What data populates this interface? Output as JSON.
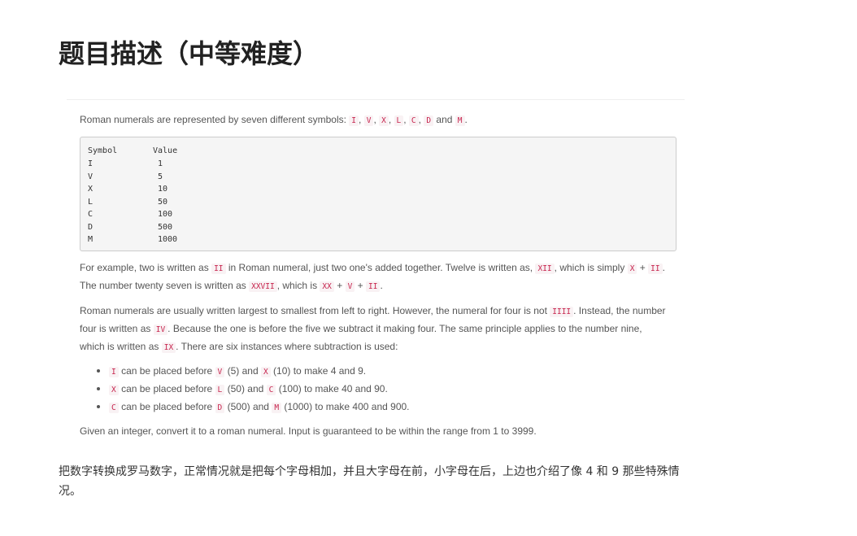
{
  "page_title": "题目描述（中等难度）",
  "intro": {
    "text": "Roman numerals are represented by seven different symbols:",
    "symbols": [
      "I",
      "V",
      "X",
      "L",
      "C",
      "D",
      "M"
    ],
    "and_word": "and",
    "end": "."
  },
  "table": {
    "headers": {
      "symbol": "Symbol",
      "value": "Value"
    },
    "rows": [
      {
        "symbol": "I",
        "value": "1"
      },
      {
        "symbol": "V",
        "value": "5"
      },
      {
        "symbol": "X",
        "value": "10"
      },
      {
        "symbol": "L",
        "value": "50"
      },
      {
        "symbol": "C",
        "value": "100"
      },
      {
        "symbol": "D",
        "value": "500"
      },
      {
        "symbol": "M",
        "value": "1000"
      }
    ]
  },
  "example": {
    "l1_a": "For example, two is written as",
    "l1_code1": "II",
    "l1_b": "in Roman numeral, just two one's added together. Twelve is written as,",
    "l1_code2": "XII",
    "l1_c": ", which is simply",
    "l1_code3": "X",
    "l1_plus": "+",
    "l1_code4": "II",
    "l1_end": ".",
    "l2_a": "The number twenty seven is written as",
    "l2_code1": "XXVII",
    "l2_b": ", which is",
    "l2_code2": "XX",
    "l2_plus1": "+",
    "l2_code3": "V",
    "l2_plus2": "+",
    "l2_code4": "II",
    "l2_end": "."
  },
  "order": {
    "l1_a": "Roman numerals are usually written largest to smallest from left to right. However, the numeral for four is not",
    "l1_code": "IIII",
    "l1_b": ". Instead, the number",
    "l2_a": "four is written as",
    "l2_code": "IV",
    "l2_b": ". Because the one is before the five we subtract it making four. The same principle applies to the number nine,",
    "l3_a": "which is written as",
    "l3_code": "IX",
    "l3_b": ". There are six instances where subtraction is used:"
  },
  "rules": [
    {
      "code1": "I",
      "t1": "can be placed before",
      "code2": "V",
      "t2": "(5) and",
      "code3": "X",
      "t3": "(10) to make 4 and 9."
    },
    {
      "code1": "X",
      "t1": "can be placed before",
      "code2": "L",
      "t2": "(50) and",
      "code3": "C",
      "t3": "(100) to make 40 and 90."
    },
    {
      "code1": "C",
      "t1": "can be placed before",
      "code2": "D",
      "t2": "(500) and",
      "code3": "M",
      "t3": "(1000) to make 400 and 900."
    }
  ],
  "task": "Given an integer, convert it to a roman numeral. Input is guaranteed to be within the range from 1 to 3999.",
  "summary": "把数字转换成罗马数字，正常情况就是把每个字母相加，并且大字母在前，小字母在后，上边也介绍了像 4 和 9 那些特殊情况。"
}
